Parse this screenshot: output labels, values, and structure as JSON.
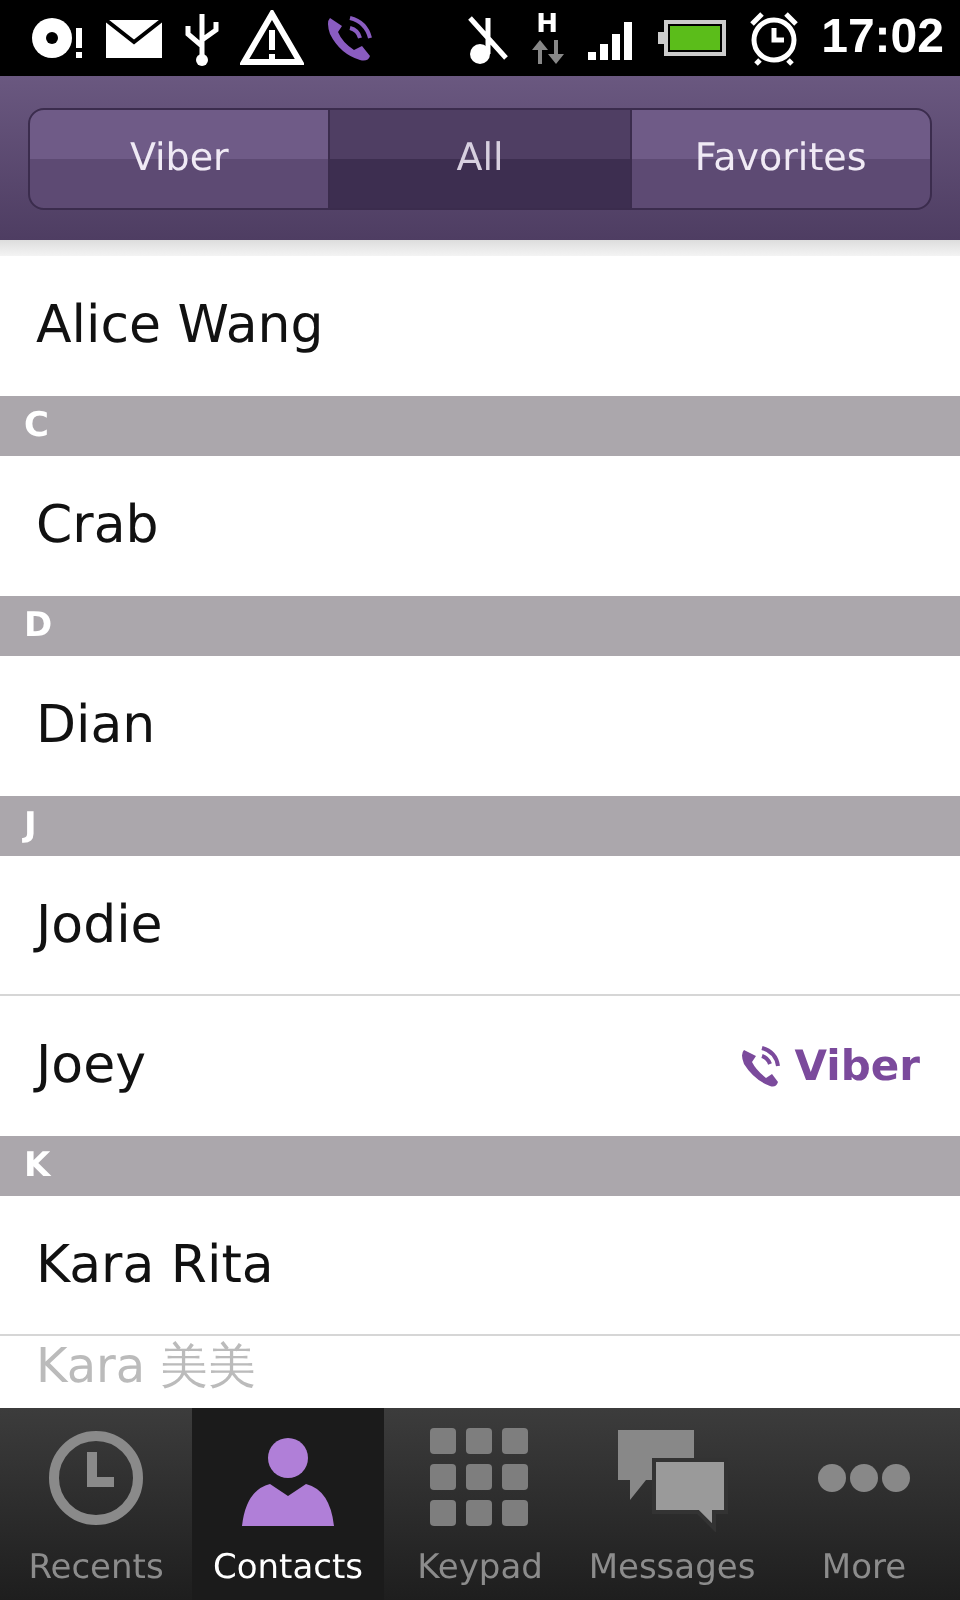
{
  "status_bar": {
    "network_type": "H",
    "time": "17:02"
  },
  "tabs": [
    {
      "label": "Viber",
      "selected": false
    },
    {
      "label": "All",
      "selected": true
    },
    {
      "label": "Favorites",
      "selected": false
    }
  ],
  "contacts": [
    {
      "kind": "contact",
      "name": "Alice Wang"
    },
    {
      "kind": "header",
      "name": "C"
    },
    {
      "kind": "contact",
      "name": "Crab"
    },
    {
      "kind": "header",
      "name": "D"
    },
    {
      "kind": "contact",
      "name": "Dian"
    },
    {
      "kind": "header",
      "name": "J"
    },
    {
      "kind": "contact",
      "name": "Jodie"
    },
    {
      "kind": "contact",
      "name": "Joey",
      "badge": "Viber"
    },
    {
      "kind": "header",
      "name": "K"
    },
    {
      "kind": "contact",
      "name": "Kara Rita"
    },
    {
      "kind": "contact",
      "name": "Kara 美美"
    }
  ],
  "bottom_nav": [
    {
      "label": "Recents",
      "selected": false
    },
    {
      "label": "Contacts",
      "selected": true
    },
    {
      "label": "Keypad",
      "selected": false
    },
    {
      "label": "Messages",
      "selected": false
    },
    {
      "label": "More",
      "selected": false
    }
  ]
}
